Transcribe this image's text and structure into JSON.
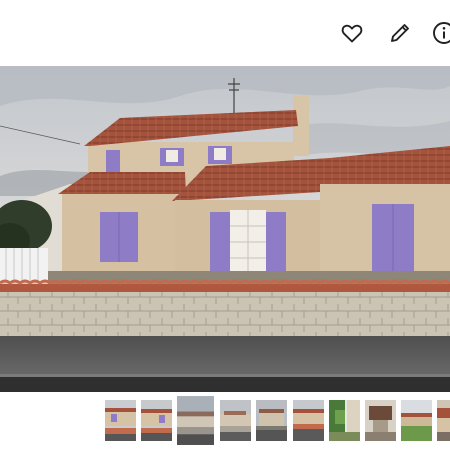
{
  "toolbar": {
    "icons": [
      "heart-icon",
      "pencil-icon",
      "info-icon"
    ]
  },
  "photo": {
    "subject": "house-facade",
    "colors": {
      "sky": "#c9ccd0",
      "roof": "#a5523c",
      "wall": "#d7c2a4",
      "shutter": "#8f7cc6",
      "stone_wall": "#cbc3b4",
      "road": "#565656"
    }
  },
  "gallery": {
    "thumbnail_count": 10,
    "selected_index": 2
  }
}
